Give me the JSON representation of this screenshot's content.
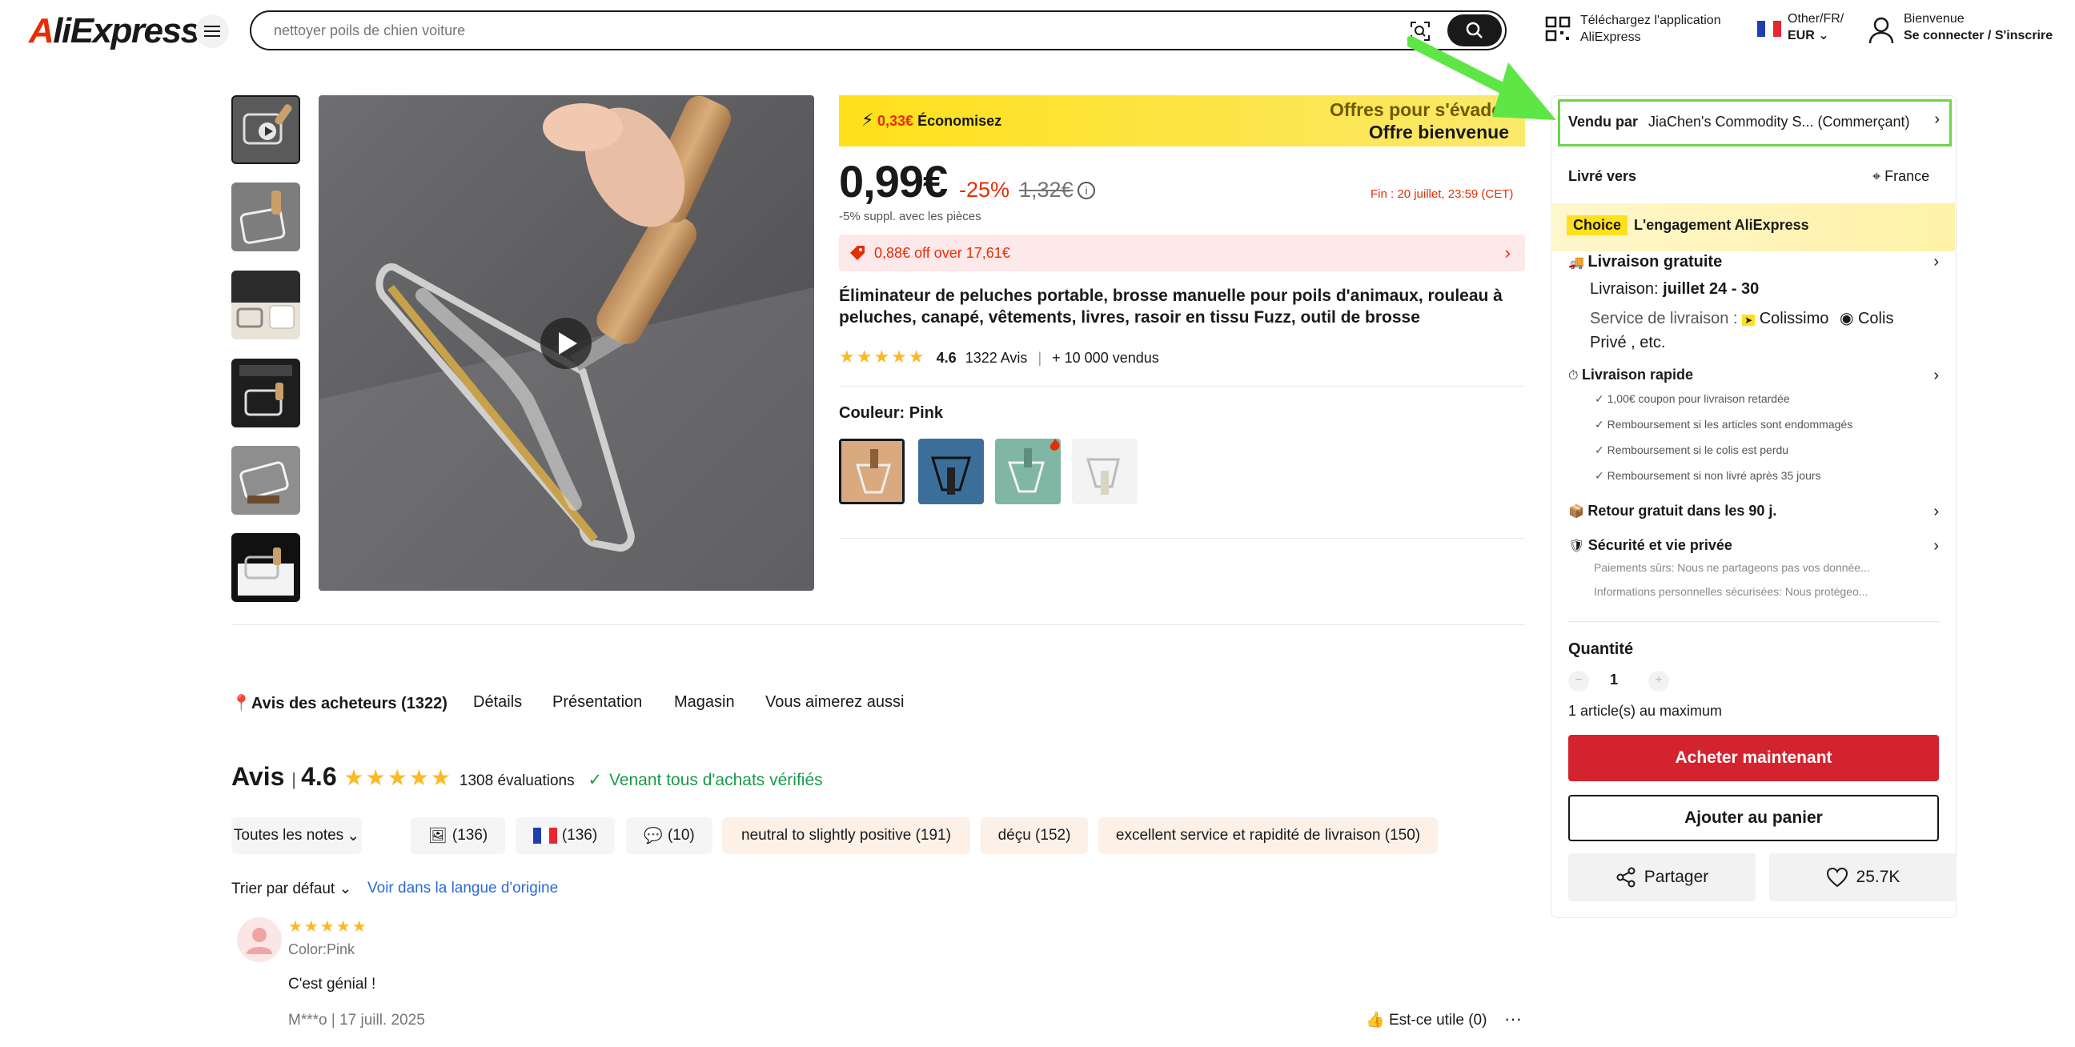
{
  "header": {
    "logo": "AliExpress",
    "search_placeholder": "nettoyer poils de chien voiture",
    "app_line1": "Téléchargez l'application",
    "app_line2": "AliExpress",
    "locale_line1": "Other/FR/",
    "locale_line2": "EUR",
    "account_line1": "Bienvenue",
    "account_line2": "Se connecter / S'inscrire"
  },
  "promo": {
    "savings_amount": "0,33€",
    "savings_label": "Économisez",
    "offer_line1": "Offres pour s'évader",
    "offer_line2": "Offre bienvenue"
  },
  "price": {
    "current": "0,99€",
    "discount": "-25%",
    "original": "1,32€",
    "extra": "-5% suppl. avec les pièces",
    "deadline_label": "Fin :",
    "deadline": "20 juillet, 23:59 (CET)",
    "coupon": "0,88€ off over 17,61€"
  },
  "product": {
    "title": "Éliminateur de peluches portable, brosse manuelle pour poils d'animaux, rouleau à peluches, canapé, vêtements, livres, rasoir en tissu Fuzz, outil de brosse",
    "rating": "4.6",
    "reviews": "1322 Avis",
    "sold": "+ 10 000 vendus",
    "color_label": "Couleur: Pink"
  },
  "tabs": [
    "Avis des acheteurs (1322)",
    "Détails",
    "Présentation",
    "Magasin",
    "Vous aimerez aussi"
  ],
  "reviews_section": {
    "title": "Avis",
    "rating": "4.6",
    "count": "1308 évaluations",
    "verified": "Venant tous d'achats vérifiés",
    "filters": [
      "Toutes les notes",
      "(136)",
      "(136)",
      "(10)",
      "neutral to slightly positive (191)",
      "déçu (152)",
      "excellent service et rapidité de livraison (150)"
    ],
    "sort": "Trier par défaut",
    "original_language": "Voir dans la langue d'origine",
    "review": {
      "variant": "Color:Pink",
      "text": "C'est génial !",
      "author_date": "M***o | 17 juill. 2025",
      "helpful": "Est-ce utile (0)"
    }
  },
  "panel": {
    "sold_by_label": "Vendu par",
    "seller": "JiaChen's Commodity S... (Commerçant)",
    "ship_to_label": "Livré vers",
    "ship_to": "France",
    "choice_badge": "Choice",
    "choice_title": "L'engagement AliExpress",
    "free_delivery": "Livraison gratuite",
    "delivery_label": "Livraison:",
    "delivery_dates": "juillet 24 - 30",
    "service_label": "Service de livraison :",
    "carrier1": "Colissimo",
    "carrier2": "Colis",
    "carrier_rest": "Privé , etc.",
    "fast_delivery": "Livraison rapide",
    "fast_items": [
      "1,00€ coupon pour livraison retardée",
      "Remboursement si les articles sont endommagés",
      "Remboursement si le colis est perdu",
      "Remboursement si non livré après 35 jours"
    ],
    "free_return": "Retour gratuit dans les 90 j.",
    "security": "Sécurité et vie privée",
    "security_items": [
      "Paiements sûrs: Nous ne partageons pas vos donnée...",
      "Informations personnelles sécurisées: Nous protégeo..."
    ],
    "quantity_label": "Quantité",
    "quantity": "1",
    "max_note": "1 article(s) au maximum",
    "buy_now": "Acheter maintenant",
    "add_cart": "Ajouter au panier",
    "share": "Partager",
    "wishlist_count": "25.7K"
  },
  "colors": {
    "accent_red": "#d3232f",
    "promo_yellow": "#ffe01a",
    "star": "#fdb924",
    "verified_green": "#1a9b4b",
    "highlight_green": "#6fd44b"
  }
}
